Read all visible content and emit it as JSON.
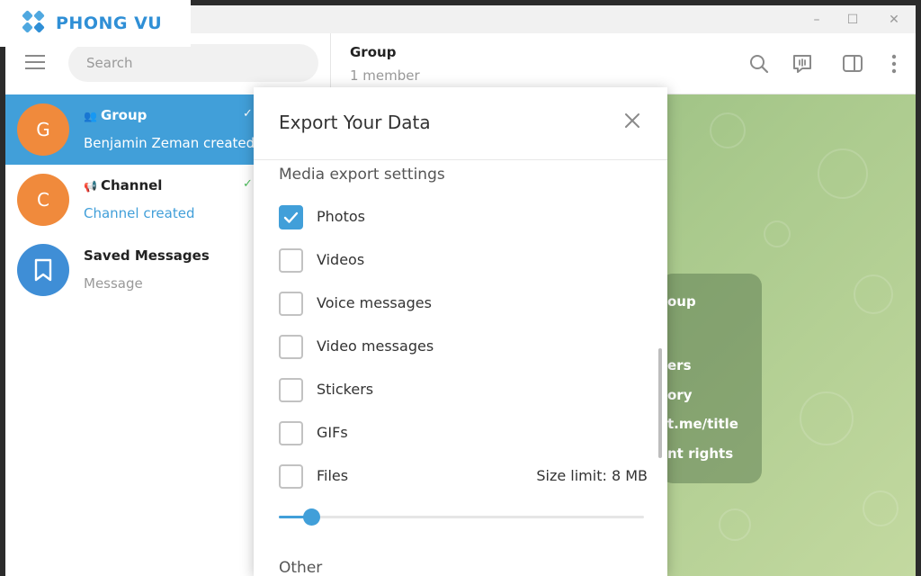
{
  "brand": {
    "logo_text": "PHONG VU"
  },
  "window": {
    "minimize": "–",
    "maximize": "☐",
    "close": "✕"
  },
  "sidebar": {
    "search_placeholder": "Search",
    "chats": [
      {
        "initial": "G",
        "name": "Group",
        "preview": "Benjamin Zeman created",
        "color": "#f08a3c"
      },
      {
        "initial": "C",
        "name": "Channel",
        "preview": "Channel created",
        "color": "#f08a3c"
      },
      {
        "name": "Saved Messages",
        "preview": "Message",
        "color": "#3f8ed6"
      }
    ]
  },
  "main": {
    "title": "Group",
    "subtitle": "1 member",
    "info_card": [
      "oup",
      "ers",
      "ory",
      "t.me/title",
      "nt rights"
    ]
  },
  "dialog": {
    "title": "Export Your Data",
    "section": "Media export settings",
    "options": [
      {
        "label": "Photos",
        "checked": true
      },
      {
        "label": "Videos",
        "checked": false
      },
      {
        "label": "Voice messages",
        "checked": false
      },
      {
        "label": "Video messages",
        "checked": false
      },
      {
        "label": "Stickers",
        "checked": false
      },
      {
        "label": "GIFs",
        "checked": false
      },
      {
        "label": "Files",
        "checked": false
      }
    ],
    "size_limit": "Size limit: 8 MB",
    "slider_fraction": 0.09,
    "next_section": "Other"
  },
  "colors": {
    "accent": "#419fd9",
    "chat_bg": "#a9c98c"
  }
}
